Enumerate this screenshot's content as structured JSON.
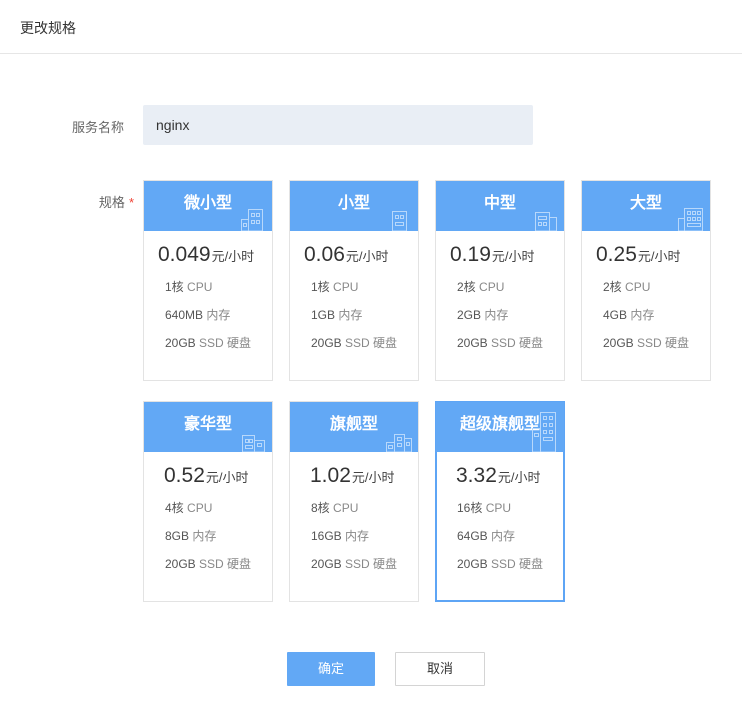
{
  "dialog": {
    "title": "更改规格"
  },
  "form": {
    "name_label": "服务名称",
    "name_value": "nginx",
    "spec_label": "规格",
    "required_mark": "*"
  },
  "price_unit": "元/小时",
  "cards": [
    {
      "name": "微小型",
      "price": "0.049",
      "cpu": "1核",
      "cpu_suffix": "CPU",
      "mem": "640MB",
      "mem_suffix": "内存",
      "disk": "20GB",
      "disk_suffix": "SSD 硬盘",
      "selected": false
    },
    {
      "name": "小型",
      "price": "0.06",
      "cpu": "1核",
      "cpu_suffix": "CPU",
      "mem": "1GB",
      "mem_suffix": "内存",
      "disk": "20GB",
      "disk_suffix": "SSD 硬盘",
      "selected": false
    },
    {
      "name": "中型",
      "price": "0.19",
      "cpu": "2核",
      "cpu_suffix": "CPU",
      "mem": "2GB",
      "mem_suffix": "内存",
      "disk": "20GB",
      "disk_suffix": "SSD 硬盘",
      "selected": false
    },
    {
      "name": "大型",
      "price": "0.25",
      "cpu": "2核",
      "cpu_suffix": "CPU",
      "mem": "4GB",
      "mem_suffix": "内存",
      "disk": "20GB",
      "disk_suffix": "SSD 硬盘",
      "selected": false
    },
    {
      "name": "豪华型",
      "price": "0.52",
      "cpu": "4核",
      "cpu_suffix": "CPU",
      "mem": "8GB",
      "mem_suffix": "内存",
      "disk": "20GB",
      "disk_suffix": "SSD 硬盘",
      "selected": false
    },
    {
      "name": "旗舰型",
      "price": "1.02",
      "cpu": "8核",
      "cpu_suffix": "CPU",
      "mem": "16GB",
      "mem_suffix": "内存",
      "disk": "20GB",
      "disk_suffix": "SSD 硬盘",
      "selected": false
    },
    {
      "name": "超级旗舰型",
      "price": "3.32",
      "cpu": "16核",
      "cpu_suffix": "CPU",
      "mem": "64GB",
      "mem_suffix": "内存",
      "disk": "20GB",
      "disk_suffix": "SSD 硬盘",
      "selected": true
    }
  ],
  "buttons": {
    "confirm": "确定",
    "cancel": "取消"
  },
  "colors": {
    "accent": "#62a8f5",
    "input_bg": "#e9eef5",
    "required": "#f04134"
  }
}
